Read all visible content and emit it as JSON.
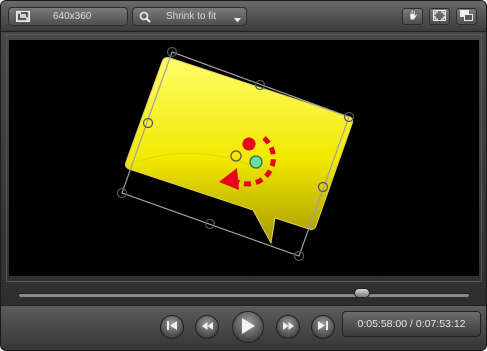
{
  "toolbar": {
    "dimensions_label": "640x360",
    "zoom_label": "Shrink to fit",
    "icons": [
      "crop-icon",
      "search-icon",
      "chevron-down-icon",
      "pan-hand-icon",
      "fullscreen-icon",
      "detach-window-icon"
    ]
  },
  "stage": {
    "background": "#000000",
    "callout_fill_top": "#ffff4a",
    "callout_fill_bottom": "#b8a800",
    "rotate_arrow_color": "#e8001c",
    "center_handle_color": "#66e0a0"
  },
  "playback": {
    "progress_fraction": 0.77,
    "time_display": "0:05:58:00 / 0:07:53:12",
    "buttons": [
      "jump-to-start",
      "rewind",
      "play",
      "fast-forward",
      "jump-to-end"
    ]
  }
}
